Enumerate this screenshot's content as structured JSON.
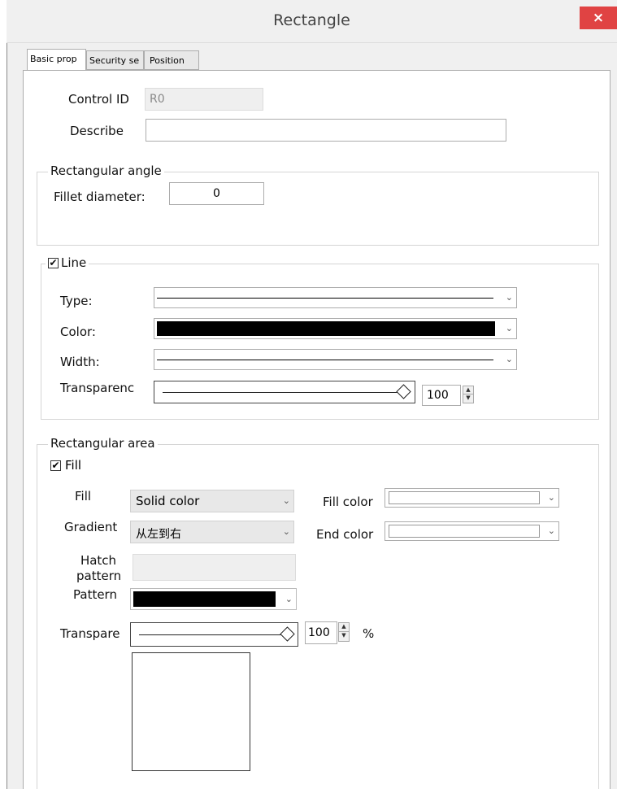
{
  "window": {
    "title": "Rectangle",
    "close_glyph": "×"
  },
  "tabs": [
    {
      "label": "Basic prop",
      "active": true
    },
    {
      "label": "Security se",
      "active": false
    },
    {
      "label": "Position",
      "active": false
    }
  ],
  "basic": {
    "control_id_label": "Control ID",
    "control_id_value": "R0",
    "describe_label": "Describe",
    "describe_value": ""
  },
  "rect_angle": {
    "legend": "Rectangular angle",
    "fillet_label": "Fillet diameter:",
    "fillet_value": "0"
  },
  "line": {
    "legend": "Line",
    "checked": true,
    "type_label": "Type:",
    "color_label": "Color:",
    "color_value": "#000000",
    "width_label": "Width:",
    "transparency_label": "Transparenc",
    "transparency_value": "100",
    "transparency_level": 1.0
  },
  "rect_area": {
    "legend": "Rectangular area",
    "fill_checkbox_label": "Fill",
    "fill_checked": true,
    "fill_label": "Fill",
    "fill_value": "Solid color",
    "fill_color_label": "Fill color",
    "fill_color_value": "#ffffff",
    "gradient_label": "Gradient",
    "gradient_value": "从左到右",
    "end_color_label": "End color",
    "end_color_value": "#ffffff",
    "hatch_label_1": "Hatch",
    "hatch_label_2": "pattern",
    "pattern_label": "Pattern",
    "pattern_color": "#000000",
    "transparency_label": "Transpare",
    "transparency_value": "100",
    "transparency_unit": "%",
    "transparency_level": 1.0
  },
  "icons": {
    "checkmark": "✔",
    "dropdown": "⌄",
    "spin_up": "▲",
    "spin_down": "▼"
  }
}
